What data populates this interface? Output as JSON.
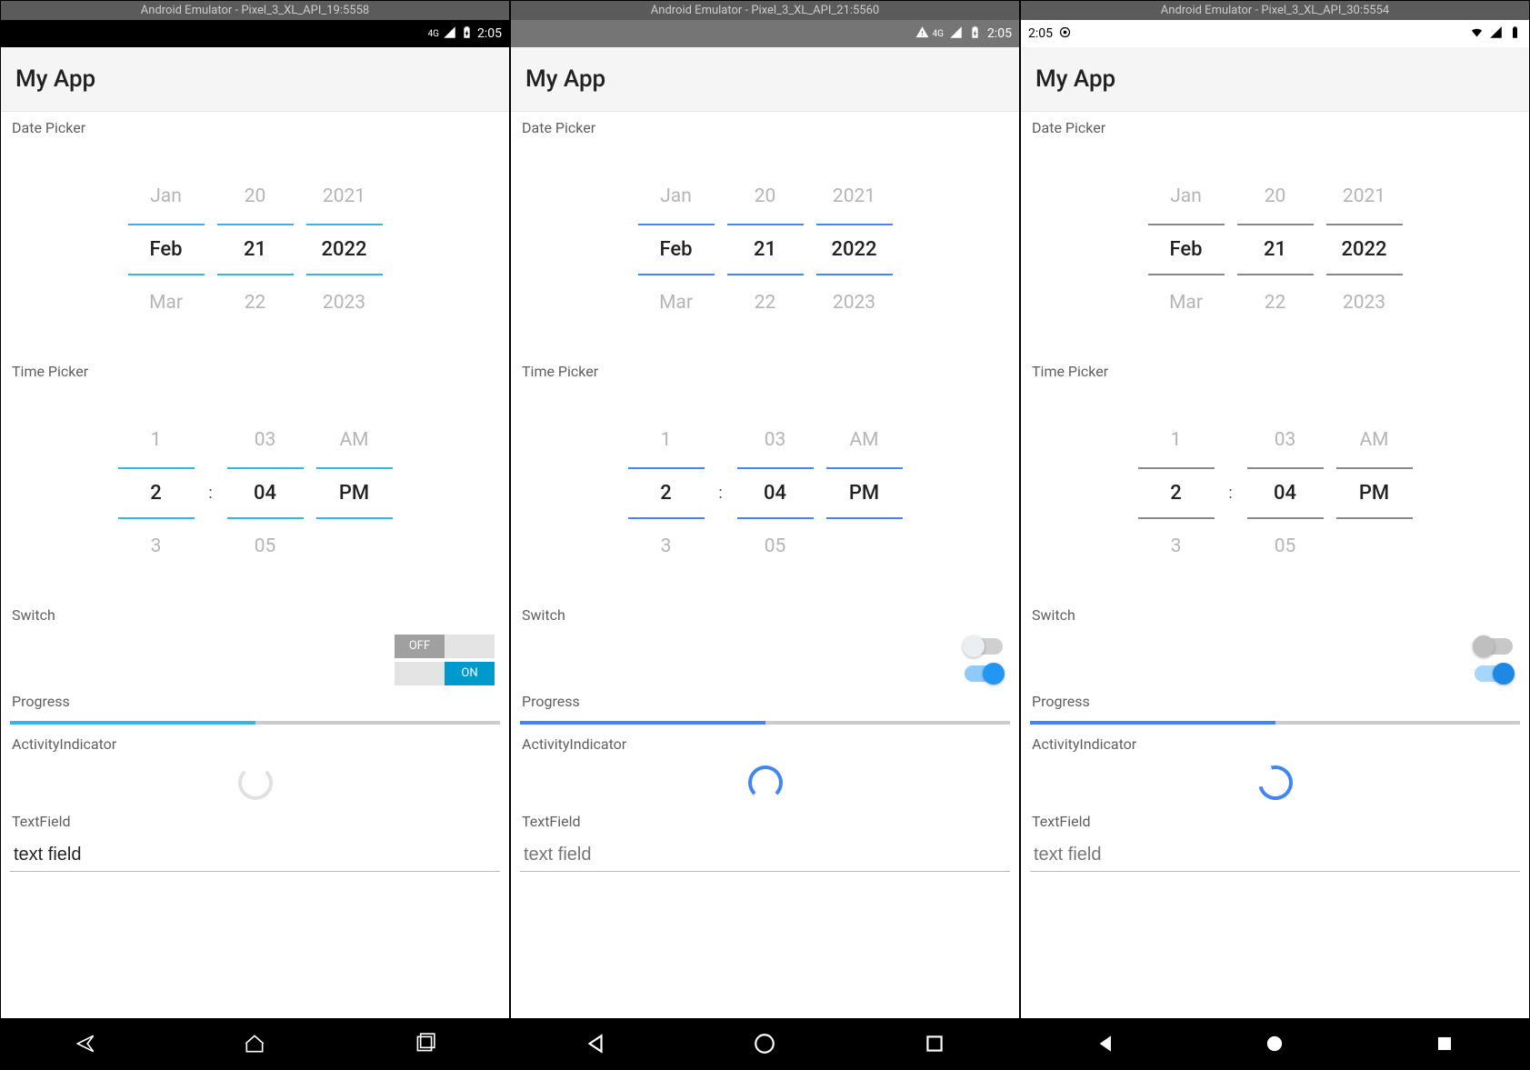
{
  "emulators": [
    {
      "title": "Android Emulator - Pixel_3_XL_API_19:5558",
      "statusbar": {
        "style": "black",
        "net": "4G",
        "time": "2:05"
      }
    },
    {
      "title": "Android Emulator - Pixel_3_XL_API_21:5560",
      "statusbar": {
        "style": "gray",
        "net": "4G",
        "time": "2:05"
      }
    },
    {
      "title": "Android Emulator - Pixel_3_XL_API_30:5554",
      "statusbar": {
        "style": "white",
        "time": "2:05"
      }
    }
  ],
  "appTitle": "My App",
  "labels": {
    "datePicker": "Date Picker",
    "timePicker": "Time Picker",
    "switch": "Switch",
    "progress": "Progress",
    "activity": "ActivityIndicator",
    "textField": "TextField"
  },
  "datePicker": {
    "month": {
      "prev": "Jan",
      "sel": "Feb",
      "next": "Mar"
    },
    "day": {
      "prev": "20",
      "sel": "21",
      "next": "22"
    },
    "year": {
      "prev": "2021",
      "sel": "2022",
      "next": "2023"
    }
  },
  "timePicker": {
    "hour": {
      "prev": "1",
      "sel": "2",
      "next": "3"
    },
    "minute": {
      "prev": "03",
      "sel": "04",
      "next": "05"
    },
    "ampm": {
      "prev": "AM",
      "sel": "PM",
      "next": ""
    },
    "colon": ":"
  },
  "switchLegacy": {
    "offLabel": "OFF",
    "onLabel": "ON"
  },
  "progressPct": 50,
  "textField": {
    "value": "text field",
    "placeholder": "text field"
  }
}
